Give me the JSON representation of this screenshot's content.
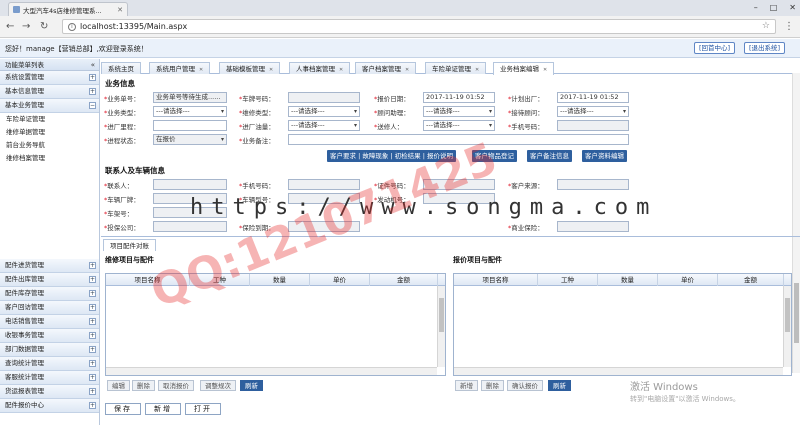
{
  "browser": {
    "tab_title": "大型汽车4s店维修管理系...",
    "url": "localhost:13395/Main.aspx"
  },
  "header": {
    "welcome": "您好！manage【营销总部】,欢迎登录系统！",
    "btn_home": "[回首中心]",
    "btn_logout": "[退出系统]"
  },
  "sidebar": {
    "title": "功能菜单列表",
    "top_groups": [
      "系统设置管理",
      "基本信息管理",
      "基本业务管理"
    ],
    "sub_items": [
      "车险单证管理",
      "维修单据管理",
      "前台业务导航",
      "维修档案管理"
    ],
    "bottom_groups": [
      "配件进货管理",
      "配件出库管理",
      "配件库存管理",
      "客户回访管理",
      "电话销售管理",
      "收银事务管理",
      "部门数据管理",
      "查询统计管理",
      "客服统计管理",
      "货运报表管理",
      "配件报价中心"
    ]
  },
  "tabs": [
    {
      "label": "系统主页"
    },
    {
      "label": "系统用户管理"
    },
    {
      "label": "基础模板管理"
    },
    {
      "label": "人事档案管理"
    },
    {
      "label": "客户档案管理"
    },
    {
      "label": "车险单证管理"
    },
    {
      "label": "业务档案编辑"
    }
  ],
  "business": {
    "title": "业务信息",
    "labels": {
      "bizno": "业务单号：",
      "plate": "车牌号码：",
      "quote_date": "报价日期：",
      "plan_date": "计划出厂：",
      "biztype": "业务类型：",
      "repair_type": "维修类型：",
      "advisor": "顾问助理：",
      "advisor2": "接待顾问：",
      "entry_mileage": "进厂里程：",
      "entry_fuel": "进厂油量：",
      "sender": "送修人：",
      "phone": "手机号码：",
      "status": "进程状态：",
      "remark": "业务备注："
    },
    "values": {
      "bizno": "业务单号等待生成......",
      "quote_date": "2017-11-19 01:52",
      "plan_date": "2017-11-19 01:52",
      "select": "---请选择---",
      "status": "在报价"
    },
    "actions": [
      "客户要求 | 故障现象 | 初检结果 | 报价说明",
      "客户物品登记",
      "客户备注信息",
      "客户资料编辑"
    ]
  },
  "customer": {
    "title": "联系人及车辆信息",
    "labels": {
      "contact": "联系人：",
      "mobile": "手机号码：",
      "id_no": "证件号码：",
      "source": "客户来源：",
      "maker": "车辆厂牌：",
      "model": "车辆型号：",
      "engine": "发动机号：",
      "vin": "车架号：",
      "insurer": "投保公司：",
      "expire": "保险到期：",
      "insure": "商业保险："
    }
  },
  "panel": {
    "tab": "项目配件对账",
    "left_title": "维修项目与配件",
    "right_title": "报价项目与配件",
    "cols_left": [
      "项目名称",
      "工种",
      "数量",
      "单价",
      "金额"
    ],
    "cols_right": [
      "项目名称",
      "工种",
      "数量",
      "单价",
      "金额"
    ],
    "left_buttons": [
      "编辑",
      "删除",
      "取消报价",
      "调整规次",
      "刷新"
    ],
    "right_buttons": [
      "新增",
      "删除",
      "确认报价",
      "刷新"
    ]
  },
  "bottom_buttons": [
    "保存",
    "新增",
    "打开"
  ],
  "watermark": {
    "url_text": "https://www.songma.com",
    "qq_text": "QQ:121071425"
  },
  "windows": {
    "activate": "激活 Windows",
    "activate_sub": "转到\"电脑设置\"以激活 Windows。"
  }
}
